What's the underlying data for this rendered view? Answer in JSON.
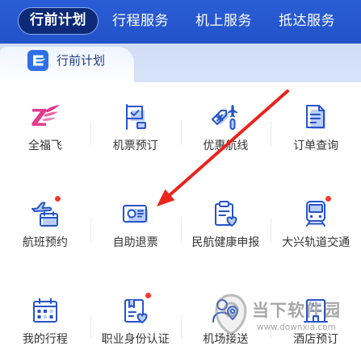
{
  "colors": {
    "header_bg": "#2152c8",
    "selected_tab_bg": "#0c2a78",
    "section_band": "#d7e3f8",
    "icon_stroke": "#2553cc",
    "icon_fill": "#b9cff6",
    "brand_pink": "#e23b8e",
    "badge": "#f0392f",
    "annotation_arrow": "#e8241c"
  },
  "top_tabs": [
    {
      "label": "行前计划",
      "selected": true
    },
    {
      "label": "行程服务",
      "selected": false
    },
    {
      "label": "机上服务",
      "selected": false
    },
    {
      "label": "抵达服务",
      "selected": false
    }
  ],
  "section": {
    "title": "行前计划",
    "icon": "plane-logo-icon"
  },
  "services": [
    {
      "label": "全福飞",
      "icon": "quanfufei-logo-icon",
      "badge": false
    },
    {
      "label": "机票预订",
      "icon": "flight-ticket-icon",
      "badge": false
    },
    {
      "label": "优惠航线",
      "icon": "discount-tag-icon",
      "badge": false
    },
    {
      "label": "订单查询",
      "icon": "order-document-icon",
      "badge": false
    },
    {
      "label": "航班预约",
      "icon": "flight-calendar-icon",
      "badge": true
    },
    {
      "label": "自助退票",
      "icon": "ticket-refund-icon",
      "badge": false
    },
    {
      "label": "民航健康申报",
      "icon": "health-clipboard-icon",
      "badge": false
    },
    {
      "label": "大兴轨道交通",
      "icon": "train-icon",
      "badge": true
    },
    {
      "label": "我的行程",
      "icon": "calendar-icon",
      "badge": false
    },
    {
      "label": "职业身份认证",
      "icon": "id-badge-icon",
      "badge": true
    },
    {
      "label": "机场接送",
      "icon": "pickup-person-icon",
      "badge": false
    },
    {
      "label": "酒店预订",
      "icon": "hotel-icon",
      "badge": false
    }
  ],
  "watermark": {
    "name": "当下软件园",
    "url": "www.downxia.com"
  }
}
